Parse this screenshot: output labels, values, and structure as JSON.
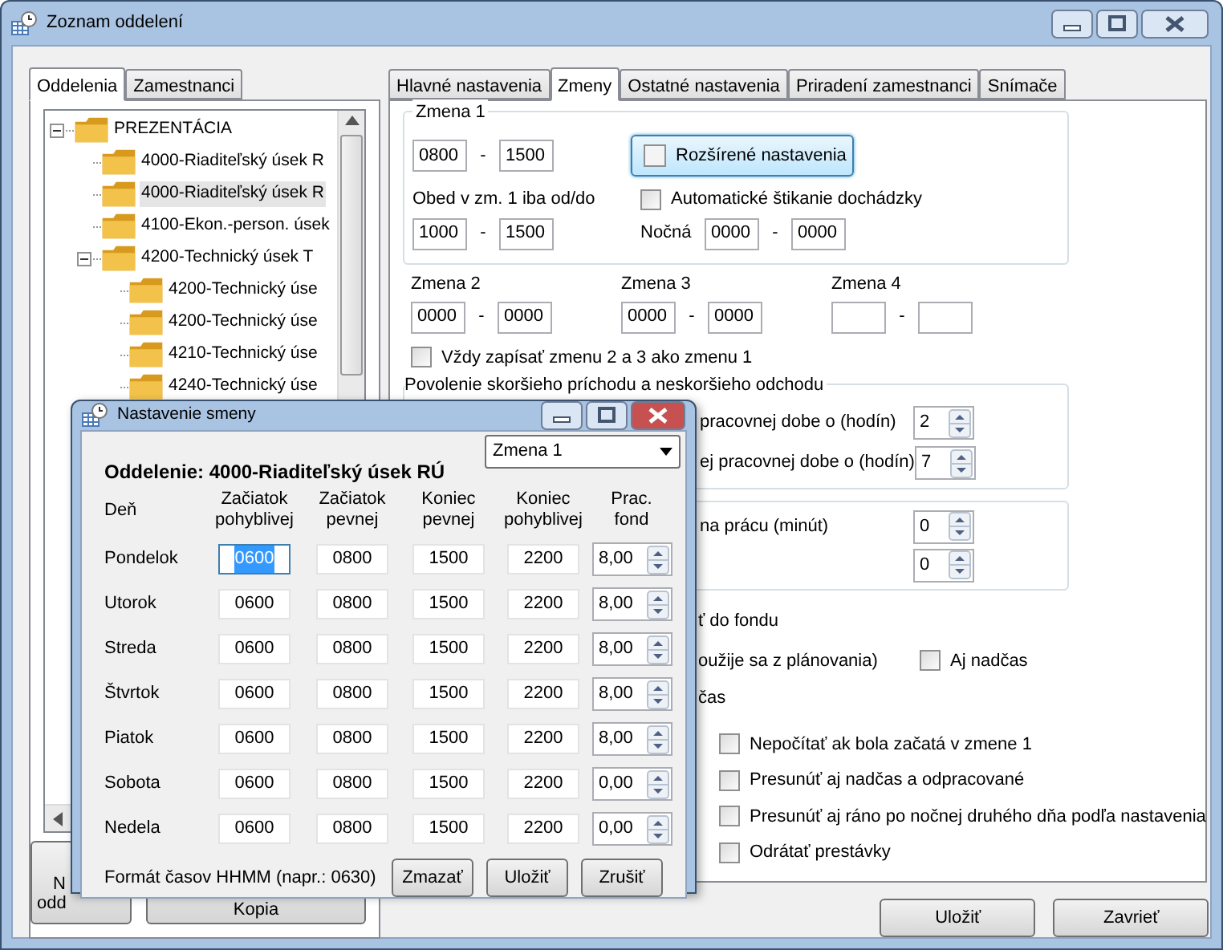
{
  "window": {
    "title": "Zoznam oddelení"
  },
  "left_tabs": [
    {
      "label": "Oddelenia",
      "selected": true
    },
    {
      "label": "Zamestnanci",
      "selected": false
    }
  ],
  "tree": [
    {
      "label": "PREZENTÁCIA",
      "expanded": true,
      "selected": false,
      "children": [
        {
          "label": "4000-Riaditeľský úsek R",
          "selected": false
        },
        {
          "label": "4000-Riaditeľský úsek R",
          "selected": true
        },
        {
          "label": "4100-Ekon.-person. úsek",
          "selected": false
        },
        {
          "label": "4200-Technický úsek T",
          "expanded": true,
          "selected": false,
          "children": [
            {
              "label": "4200-Technický úse",
              "selected": false
            },
            {
              "label": "4200-Technický úse",
              "selected": false
            },
            {
              "label": "4210-Technický úse",
              "selected": false
            },
            {
              "label": "4240-Technický úse",
              "selected": false
            }
          ]
        }
      ]
    }
  ],
  "new_button": {
    "lines": [
      "N",
      "odd"
    ]
  },
  "copy_button": {
    "label": "Kopia"
  },
  "right_tabs": [
    {
      "label": "Hlavné nastavenia",
      "selected": false
    },
    {
      "label": "Zmeny",
      "selected": true
    },
    {
      "label": "Ostatné nastavenia",
      "selected": false
    },
    {
      "label": "Priradení zamestnanci",
      "selected": false
    },
    {
      "label": "Snímače",
      "selected": false
    }
  ],
  "shift1": {
    "title": "Zmena 1",
    "time": {
      "from": "0800",
      "sep": "-",
      "to": "1500"
    },
    "extended": {
      "label": "Rozšírené nastavenia",
      "checked": false
    },
    "lunch_label": "Obed v zm. 1 iba od/do",
    "lunch": {
      "from": "1000",
      "sep": "-",
      "to": "1500"
    },
    "auto": {
      "label": "Automatické štikanie dochádzky",
      "checked": false
    },
    "night_label": "Nočná",
    "night": {
      "from": "0000",
      "sep": "-",
      "to": "0000"
    }
  },
  "shifts": [
    {
      "title": "Zmena 2",
      "from": "0000",
      "sep": "-",
      "to": "0000"
    },
    {
      "title": "Zmena 3",
      "from": "0000",
      "sep": "-",
      "to": "0000"
    },
    {
      "title": "Zmena 4",
      "sep": "-"
    }
  ],
  "always_checkbox": {
    "label": "Vždy zapísať zmenu 2 a 3 ako zmenu 1",
    "checked": false
  },
  "arrival_group": {
    "title": "Povolenie skoršieho príchodu a neskoršieho odchodu",
    "rows": [
      {
        "label": "pracovnej dobe o (hodín)",
        "value": "2"
      },
      {
        "label": "ej pracovnej dobe o (hodín)",
        "value": "7"
      }
    ]
  },
  "break_group": {
    "rows": [
      {
        "label": "na prácu (minút)",
        "value": "0"
      },
      {
        "value": "0"
      }
    ]
  },
  "fund_line": "ť do fondu",
  "planning_line": {
    "text": "oužije sa z plánovania)",
    "checkbox": {
      "label": "Aj nadčas",
      "checked": false
    }
  },
  "overtime_line": "čas",
  "options": [
    {
      "label": "Nepočítať ak bola začatá v zmene 1",
      "checked": false
    },
    {
      "label": "Presunúť aj nadčas a odpracované",
      "checked": false
    },
    {
      "label": "Presunúť aj ráno po nočnej druhého dňa podľa nastavenia",
      "checked": false
    },
    {
      "label": "Odrátať prestávky",
      "checked": false
    }
  ],
  "buttons": [
    "Uložiť",
    "Zavrieť"
  ],
  "dialog": {
    "title": "Nastavenie smeny",
    "heading": "Oddelenie: 4000-Riaditeľský úsek RÚ",
    "shift_select": "Zmena 1",
    "columns": [
      {
        "lines": [
          "Deň"
        ]
      },
      {
        "lines": [
          "Začiatok",
          "pohyblivej"
        ]
      },
      {
        "lines": [
          "Začiatok",
          "pevnej"
        ]
      },
      {
        "lines": [
          "Koniec",
          "pevnej"
        ]
      },
      {
        "lines": [
          "Koniec",
          "pohyblivej"
        ]
      },
      {
        "lines": [
          "Prac.",
          "fond"
        ]
      }
    ],
    "rows": [
      {
        "cells": [
          {
            "kind": "day",
            "value": "Pondelok"
          },
          {
            "kind": "time",
            "value": "0600",
            "selected": true
          },
          {
            "kind": "time",
            "value": "0800",
            "selected": false
          },
          {
            "kind": "time",
            "value": "1500",
            "selected": false
          },
          {
            "kind": "time",
            "value": "2200",
            "selected": false
          },
          {
            "kind": "fund",
            "value": "8,00"
          }
        ]
      },
      {
        "cells": [
          {
            "kind": "day",
            "value": "Utorok"
          },
          {
            "kind": "time",
            "value": "0600",
            "selected": false
          },
          {
            "kind": "time",
            "value": "0800",
            "selected": false
          },
          {
            "kind": "time",
            "value": "1500",
            "selected": false
          },
          {
            "kind": "time",
            "value": "2200",
            "selected": false
          },
          {
            "kind": "fund",
            "value": "8,00"
          }
        ]
      },
      {
        "cells": [
          {
            "kind": "day",
            "value": "Streda"
          },
          {
            "kind": "time",
            "value": "0600",
            "selected": false
          },
          {
            "kind": "time",
            "value": "0800",
            "selected": false
          },
          {
            "kind": "time",
            "value": "1500",
            "selected": false
          },
          {
            "kind": "time",
            "value": "2200",
            "selected": false
          },
          {
            "kind": "fund",
            "value": "8,00"
          }
        ]
      },
      {
        "cells": [
          {
            "kind": "day",
            "value": "Štvrtok"
          },
          {
            "kind": "time",
            "value": "0600",
            "selected": false
          },
          {
            "kind": "time",
            "value": "0800",
            "selected": false
          },
          {
            "kind": "time",
            "value": "1500",
            "selected": false
          },
          {
            "kind": "time",
            "value": "2200",
            "selected": false
          },
          {
            "kind": "fund",
            "value": "8,00"
          }
        ]
      },
      {
        "cells": [
          {
            "kind": "day",
            "value": "Piatok"
          },
          {
            "kind": "time",
            "value": "0600",
            "selected": false
          },
          {
            "kind": "time",
            "value": "0800",
            "selected": false
          },
          {
            "kind": "time",
            "value": "1500",
            "selected": false
          },
          {
            "kind": "time",
            "value": "2200",
            "selected": false
          },
          {
            "kind": "fund",
            "value": "8,00"
          }
        ]
      },
      {
        "cells": [
          {
            "kind": "day",
            "value": "Sobota"
          },
          {
            "kind": "time",
            "value": "0600",
            "selected": false
          },
          {
            "kind": "time",
            "value": "0800",
            "selected": false
          },
          {
            "kind": "time",
            "value": "1500",
            "selected": false
          },
          {
            "kind": "time",
            "value": "2200",
            "selected": false
          },
          {
            "kind": "fund",
            "value": "0,00"
          }
        ]
      },
      {
        "cells": [
          {
            "kind": "day",
            "value": "Nedela"
          },
          {
            "kind": "time",
            "value": "0600",
            "selected": false
          },
          {
            "kind": "time",
            "value": "0800",
            "selected": false
          },
          {
            "kind": "time",
            "value": "1500",
            "selected": false
          },
          {
            "kind": "time",
            "value": "2200",
            "selected": false
          },
          {
            "kind": "fund",
            "value": "0,00"
          }
        ]
      }
    ],
    "format_note": "Formát časov HHMM (napr.: 0630)",
    "buttons": [
      "Zmazať",
      "Uložiť",
      "Zrušiť"
    ]
  }
}
